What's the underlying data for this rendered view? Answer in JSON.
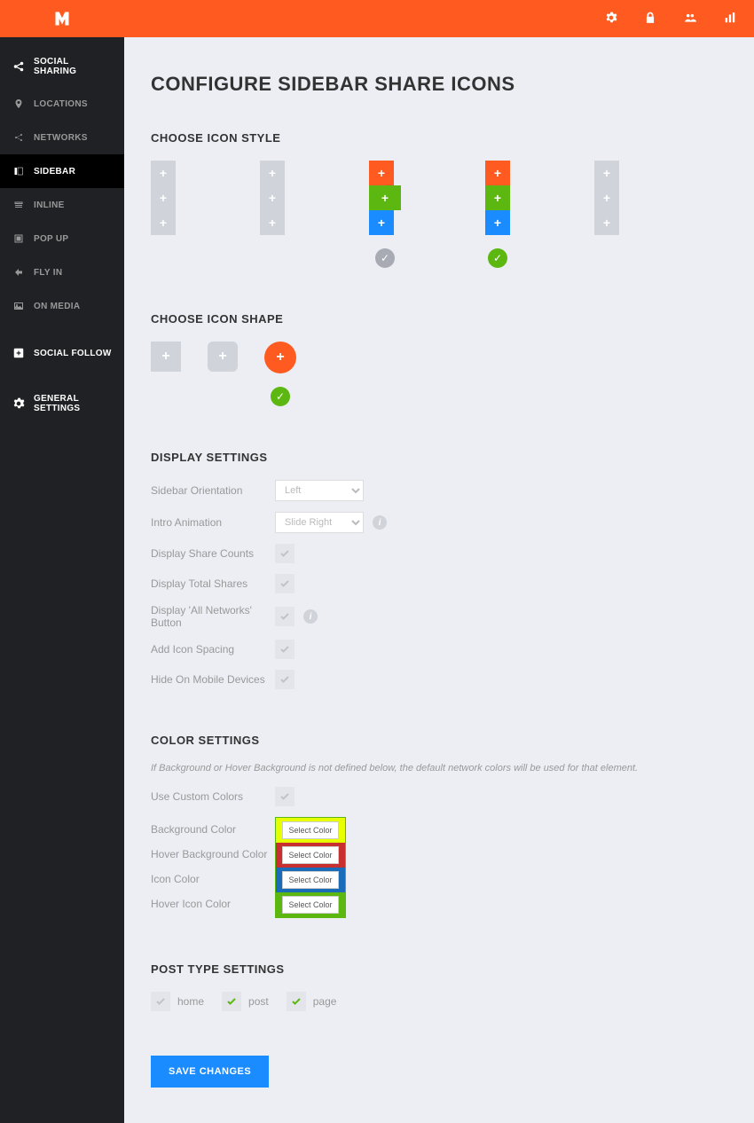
{
  "header": {
    "icons": [
      "gear",
      "lock",
      "users",
      "stats"
    ]
  },
  "sidebar": {
    "socialSharing": "SOCIAL SHARING",
    "locations": "LOCATIONS",
    "networks": "NETWORKS",
    "sidebar": "SIDEBAR",
    "inline": "INLINE",
    "popup": "POP UP",
    "flyin": "FLY IN",
    "onmedia": "ON MEDIA",
    "socialFollow": "SOCIAL FOLLOW",
    "generalSettings": "GENERAL SETTINGS"
  },
  "page": {
    "title": "CONFIGURE SIDEBAR SHARE ICONS",
    "iconStyle": {
      "heading": "CHOOSE ICON STYLE",
      "options": [
        {
          "colors": [
            "grey",
            "grey",
            "grey"
          ],
          "selected": false,
          "checkVisible": false
        },
        {
          "colors": [
            "grey",
            "grey",
            "grey"
          ],
          "selected": false,
          "checkVisible": false
        },
        {
          "colors": [
            "orange",
            "green",
            "blue"
          ],
          "selected": false,
          "checkVisible": true,
          "wide": true
        },
        {
          "colors": [
            "orange",
            "green",
            "blue"
          ],
          "selected": true,
          "checkVisible": true
        },
        {
          "colors": [
            "grey",
            "grey",
            "grey"
          ],
          "selected": false,
          "checkVisible": false
        }
      ]
    },
    "iconShape": {
      "heading": "CHOOSE ICON SHAPE",
      "options": [
        {
          "type": "square",
          "selected": false
        },
        {
          "type": "rounded",
          "selected": false
        },
        {
          "type": "circle",
          "selected": true
        }
      ]
    },
    "display": {
      "heading": "DISPLAY SETTINGS",
      "orientation": {
        "label": "Sidebar Orientation",
        "value": "Left"
      },
      "animation": {
        "label": "Intro Animation",
        "value": "Slide Right"
      },
      "shareCounts": {
        "label": "Display Share Counts",
        "checked": false
      },
      "totalShares": {
        "label": "Display Total Shares",
        "checked": false
      },
      "allNetworks": {
        "label": "Display 'All Networks' Button",
        "checked": false
      },
      "iconSpacing": {
        "label": "Add Icon Spacing",
        "checked": false
      },
      "hideMobile": {
        "label": "Hide On Mobile Devices",
        "checked": false
      }
    },
    "color": {
      "heading": "COLOR SETTINGS",
      "hint": "If Background or Hover Background is not defined below, the default network colors will be used for that element.",
      "useCustom": {
        "label": "Use Custom Colors",
        "checked": false
      },
      "bg": {
        "label": "Background Color",
        "value": "#e8ff00"
      },
      "hoverBg": {
        "label": "Hover Background Color",
        "value": "#c83030"
      },
      "icon": {
        "label": "Icon Color",
        "value": "#1a6cb8"
      },
      "hoverIcon": {
        "label": "Hover Icon Color",
        "value": "#5cb711"
      },
      "selectBtn": "Select Color"
    },
    "postType": {
      "heading": "POST TYPE SETTINGS",
      "home": {
        "label": "home",
        "checked": false
      },
      "post": {
        "label": "post",
        "checked": true
      },
      "page": {
        "label": "page",
        "checked": true
      }
    },
    "save": "SAVE CHANGES"
  }
}
